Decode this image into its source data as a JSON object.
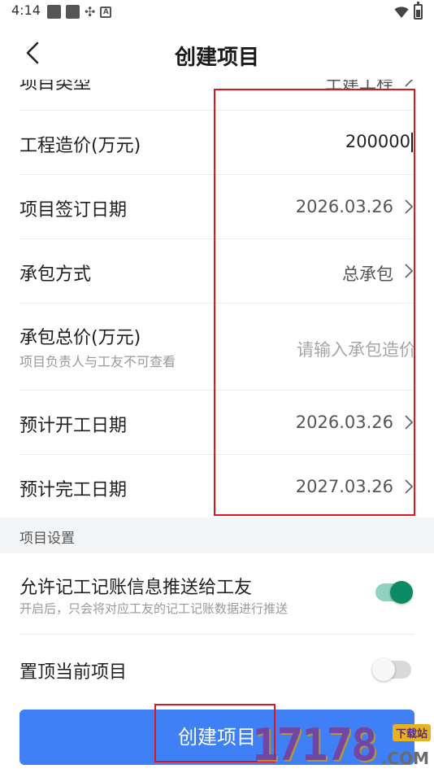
{
  "status_bar": {
    "time": "4:14",
    "icons_left": [
      "photo-icon",
      "photo-icon",
      "sync-icon",
      "a-badge-icon"
    ],
    "icons_right": [
      "wifi-icon",
      "battery-icon"
    ]
  },
  "nav": {
    "title": "创建项目",
    "back_icon": "chevron-left-icon"
  },
  "form": {
    "partial_row": {
      "label": "项目类型",
      "value": "土建工程"
    },
    "rows": [
      {
        "label": "工程造价(万元)",
        "value": "200000",
        "type": "input"
      },
      {
        "label": "项目签订日期",
        "value": "2026.03.26",
        "type": "select"
      },
      {
        "label": "承包方式",
        "value": "总承包",
        "type": "select"
      },
      {
        "label": "承包总价(万元)",
        "sublabel": "项目负责人与工友不可查看",
        "placeholder": "请输入承包造价",
        "type": "input"
      },
      {
        "label": "预计开工日期",
        "value": "2026.03.26",
        "type": "select"
      },
      {
        "label": "预计完工日期",
        "value": "2027.03.26",
        "type": "select"
      }
    ]
  },
  "settings": {
    "section_title": "项目设置",
    "items": [
      {
        "label": "允许记工记账信息推送给工友",
        "sublabel": "开启后，只会将对应工友的记工记账数据进行推送",
        "enabled": true
      },
      {
        "label": "置顶当前项目",
        "enabled": false
      }
    ]
  },
  "footer": {
    "create_label": "创建项目"
  },
  "watermark": {
    "digits": "17178",
    "badge": "下载站",
    "suffix": ".COM"
  },
  "colors": {
    "primary_button": "#3f80f6",
    "toggle_on": "#0c8a66",
    "highlight": "#e0161e"
  }
}
